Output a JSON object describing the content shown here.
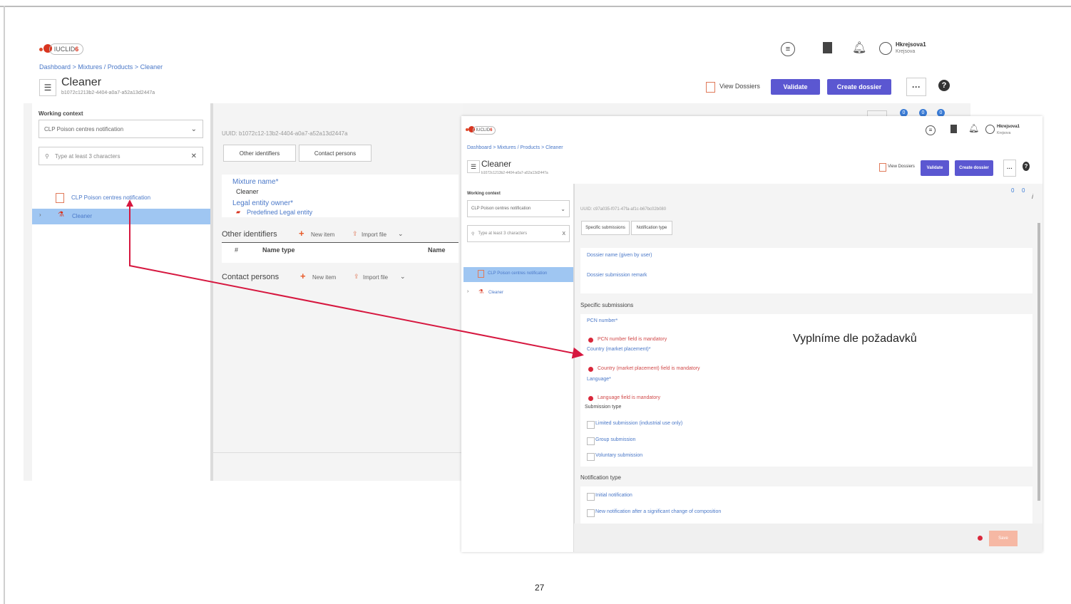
{
  "slide": {
    "page_number": "27",
    "annotation": "Vyplníme dle požadavků"
  },
  "back": {
    "logo": "IUCLID",
    "logo_version": "6",
    "user": {
      "name": "Hkrejsova1",
      "sub": "Krejsova"
    },
    "breadcrumb": "Dashboard > Mixtures / Products > Cleaner",
    "title": "Cleaner",
    "uuid": "b1072c1213b2-4404-a0a7-a52a13d2447a",
    "view_dossiers": "View Dossiers",
    "validate": "Validate",
    "create_dossier": "Create dossier",
    "working_context_label": "Working context",
    "working_context_value": "CLP Poison centres notification",
    "search_placeholder": "Type at least 3 characters",
    "tree": {
      "item1": "CLP Poison centres notification",
      "item2": "Cleaner"
    },
    "uuid_line": "UUID: b1072c12-13b2-4404-a0a7-a52a13d2447a",
    "tabs": {
      "other_identifiers": "Other identifiers",
      "contact_persons": "Contact persons"
    },
    "mixture_name_label": "Mixture name*",
    "mixture_name_value": "Cleaner",
    "legal_entity_label": "Legal entity owner*",
    "legal_entity_value": "Predefined Legal entity",
    "other_identifiers_title": "Other identifiers",
    "new_item": "New item",
    "import_file": "Import file",
    "table": {
      "hash": "#",
      "name_type": "Name type",
      "name": "Name"
    },
    "contact_persons_title": "Contact persons",
    "badges": [
      "0",
      "0",
      "0"
    ]
  },
  "front": {
    "logo": "IUCLID",
    "logo_version": "6",
    "user": {
      "name": "Hkrejsova1",
      "sub": "Krejsova"
    },
    "breadcrumb": "Dashboard > Mixtures / Products > Cleaner",
    "title": "Cleaner",
    "uuid": "b1072c1213b2-4404-a0a7-a52a13d2447a",
    "view_dossiers": "View Dossiers",
    "validate": "Validate",
    "create_dossier": "Create dossier",
    "working_context_label": "Working context",
    "working_context_value": "CLP Poison centres notification",
    "search_placeholder": "Type at least 3 characters",
    "tree": {
      "item1": "CLP Poison centres notification",
      "item2": "Cleaner"
    },
    "uuid_line": "UUID: c97a035-f071-47fa-af1c-b67bc02b080",
    "tabs": {
      "specific_submissions": "Specific submissions",
      "notification_type": "Notification type"
    },
    "dossier_name": "Dossier name (given by user)",
    "dossier_remark": "Dossier submission remark",
    "specific_submissions_title": "Specific submissions",
    "pcn_label": "PCN number*",
    "pcn_error": "PCN number field is mandatory",
    "country_label": "Country (market placement)*",
    "country_error": "Country (market placement) field is mandatory",
    "language_label": "Language*",
    "language_error": "Language field is mandatory",
    "submission_type_label": "Submission type",
    "submission_options": [
      "Limited submission (industrial use only)",
      "Group submission",
      "Voluntary submission"
    ],
    "notification_type_title": "Notification type",
    "notification_options": [
      "Initial notification",
      "New notification after a significant change of composition"
    ],
    "save": "Save",
    "badges": [
      "0",
      "0"
    ]
  },
  "colors": {
    "accent": "#5b57d1",
    "link": "#4a78c8",
    "error": "#d9283b",
    "arrow": "#d6173f",
    "tree_selected": "#9fc6f2",
    "save": "#f6b8a4"
  }
}
